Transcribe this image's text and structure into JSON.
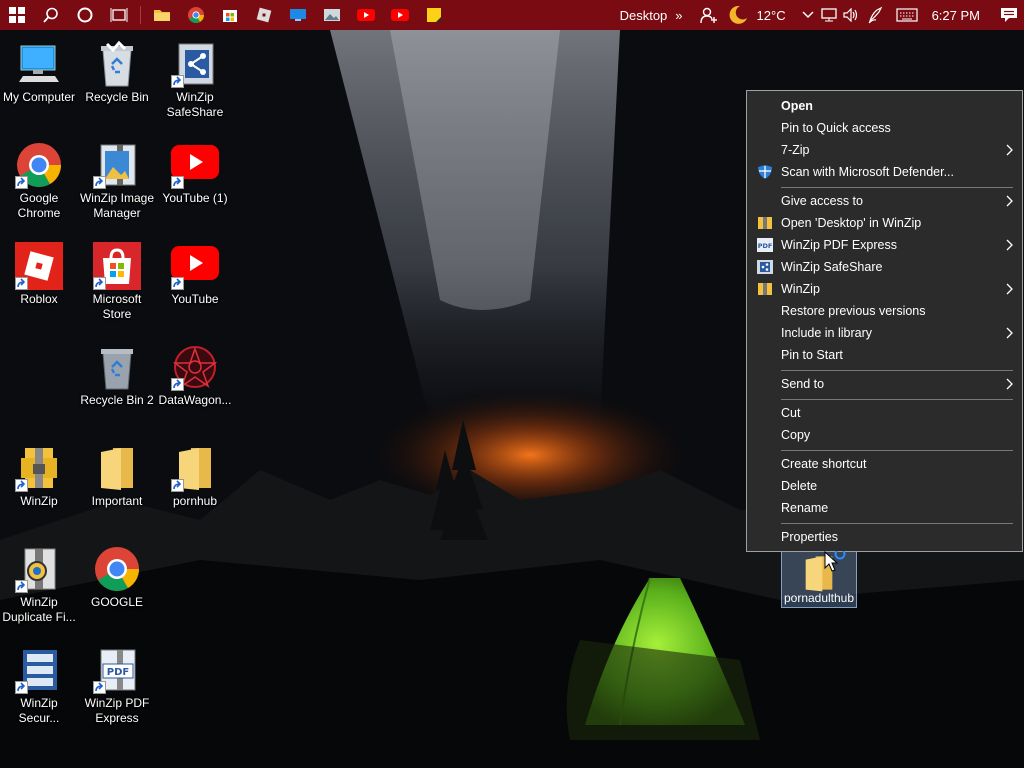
{
  "taskbar": {
    "toolbar_label": "Desktop",
    "toolbar_chevron": "»",
    "temperature": "12°C",
    "clock": "6:27 PM",
    "colors": {
      "background": "#7a0b12"
    }
  },
  "desktop": {
    "icons": [
      {
        "label": "My Computer",
        "icon": "computer-icon"
      },
      {
        "label": "Recycle Bin",
        "icon": "recycle-bin-full-icon"
      },
      {
        "label": "WinZip SafeShare",
        "icon": "winzip-safeshare-icon"
      },
      {
        "label": "Google Chrome",
        "icon": "chrome-icon"
      },
      {
        "label": "WinZip Image Manager",
        "icon": "winzip-image-manager-icon"
      },
      {
        "label": "YouTube (1)",
        "icon": "youtube-icon"
      },
      {
        "label": "Roblox",
        "icon": "roblox-icon"
      },
      {
        "label": "Microsoft Store",
        "icon": "store-icon"
      },
      {
        "label": "YouTube",
        "icon": "youtube-icon"
      },
      {
        "label": "Recycle Bin 2",
        "icon": "recycle-bin-icon"
      },
      {
        "label": "DataWagon...",
        "icon": "datawagon-icon"
      },
      {
        "label": "WinZip",
        "icon": "winzip-icon"
      },
      {
        "label": "Important",
        "icon": "folder-icon"
      },
      {
        "label": "pornhub",
        "icon": "folder-icon"
      },
      {
        "label": "WinZip Duplicate Fi...",
        "icon": "winzip-duplicate-icon"
      },
      {
        "label": "GOOGLE",
        "icon": "chrome-icon"
      },
      {
        "label": "WinZip Secur...",
        "icon": "winzip-secure-icon"
      },
      {
        "label": "WinZip PDF Express",
        "icon": "winzip-pdf-icon"
      }
    ],
    "selected_item": {
      "label": "pornadulthub",
      "icon": "folder-icon"
    }
  },
  "context_menu": {
    "items": [
      {
        "label": "Open"
      },
      {
        "label": "Pin to Quick access"
      },
      {
        "label": "7-Zip"
      },
      {
        "label": "Scan with Microsoft Defender..."
      },
      {
        "label": "Give access to"
      },
      {
        "label": "Open 'Desktop' in WinZip"
      },
      {
        "label": "WinZip PDF Express"
      },
      {
        "label": "WinZip SafeShare"
      },
      {
        "label": "WinZip"
      },
      {
        "label": "Restore previous versions"
      },
      {
        "label": "Include in library"
      },
      {
        "label": "Pin to Start"
      },
      {
        "label": "Send to"
      },
      {
        "label": "Cut"
      },
      {
        "label": "Copy"
      },
      {
        "label": "Create shortcut"
      },
      {
        "label": "Delete"
      },
      {
        "label": "Rename"
      },
      {
        "label": "Properties"
      }
    ]
  }
}
